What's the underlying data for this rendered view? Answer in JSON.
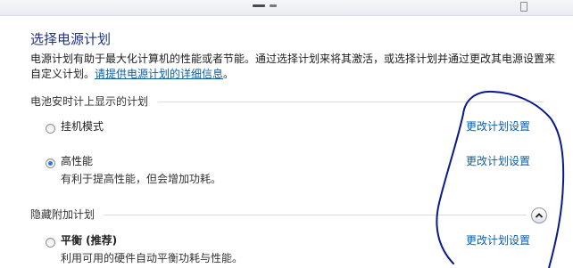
{
  "header": {
    "title": "选择电源计划",
    "description": "电源计划有助于最大化计算机的性能或者节能。通过选择计划来将其激活，或选择计划并通过更改其电源设置来自定义计划。",
    "link": "请提供电源计划的详细信息",
    "link_suffix": "。"
  },
  "sections": {
    "battery": {
      "title": "电池安时计上显示的计划",
      "plans": [
        {
          "name": "挂机模式",
          "description": "",
          "selected": false,
          "change_link": "更改计划设置"
        },
        {
          "name": "高性能",
          "description": "有利于提高性能，但会增加功耗。",
          "selected": true,
          "change_link": "更改计划设置"
        }
      ]
    },
    "hidden": {
      "title": "隐藏附加计划",
      "collapse_icon": "chevron-up-icon",
      "plans": [
        {
          "name": "平衡 (推荐)",
          "description": "利用可用的硬件自动平衡功耗与性能。",
          "selected": false,
          "change_link": "更改计划设置"
        }
      ]
    }
  },
  "colors": {
    "title": "#1e3287",
    "link": "#0b5ea8",
    "radio_selected": "#2f7cd0",
    "annotation_ink": "#0a1a8c"
  }
}
